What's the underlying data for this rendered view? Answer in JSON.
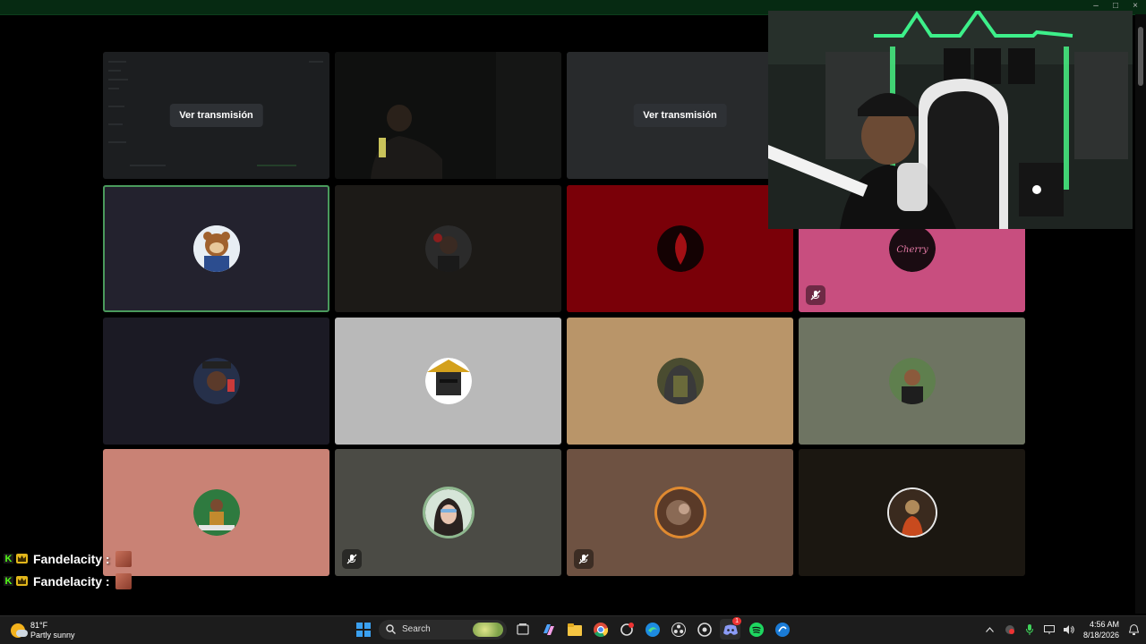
{
  "window": {
    "controls": [
      "–",
      "□",
      "×"
    ]
  },
  "stream_tiles": [
    {
      "label": "Ver transmisión"
    },
    {
      "label": "Ver transmisión"
    }
  ],
  "colors": {
    "tile_dark": "#23222e",
    "tile_black": "#1c1a17",
    "tile_red": "#7a0008",
    "tile_pink": "#c84e7f",
    "tile_navy": "#1b1a24",
    "tile_gray": "#b9b9b9",
    "tile_tan": "#b99569",
    "tile_sage": "#6e7462",
    "tile_salmon": "#c98275",
    "tile_olive": "#4b4b45",
    "tile_brown": "#6e5242",
    "tile_espresso": "#1b1711",
    "selected_border": "#4a9a5c"
  },
  "chat": {
    "messages": [
      {
        "badge": "K",
        "user": "Fandelacity :"
      },
      {
        "badge": "K",
        "user": "Fandelacity :"
      }
    ]
  },
  "taskbar": {
    "weather_temp": "81°F",
    "weather_desc": "Partly sunny",
    "search_placeholder": "Search",
    "time": "4:56 AM",
    "date": "8/18/2026",
    "discord_badge": "1"
  }
}
